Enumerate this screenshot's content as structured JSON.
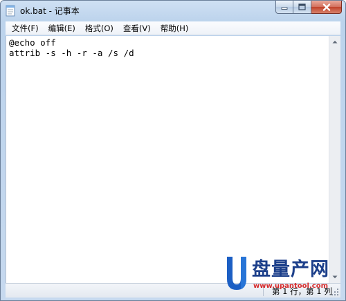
{
  "window": {
    "title": "ok.bat - 记事本"
  },
  "menu": {
    "items": [
      {
        "label": "文件(F)"
      },
      {
        "label": "编辑(E)"
      },
      {
        "label": "格式(O)"
      },
      {
        "label": "查看(V)"
      },
      {
        "label": "帮助(H)"
      }
    ]
  },
  "editor": {
    "lines": [
      "@echo off",
      "attrib -s -h -r -a /s /d"
    ]
  },
  "statusbar": {
    "position": "第 1 行，第 1 列"
  },
  "watermark": {
    "brand": "盘量产网",
    "url": "www.upantool.com"
  },
  "icons": {
    "app": "notepad-icon",
    "minimize": "minimize-icon",
    "maximize": "maximize-icon",
    "close": "close-icon",
    "scroll_up": "arrow-up-icon",
    "scroll_down": "arrow-down-icon",
    "grip": "size-grip-icon"
  },
  "colors": {
    "title_bar": "#bcd3ec",
    "close_button": "#c1432b",
    "watermark_blue": "#1c3f8a",
    "watermark_red": "#d62b2b"
  }
}
